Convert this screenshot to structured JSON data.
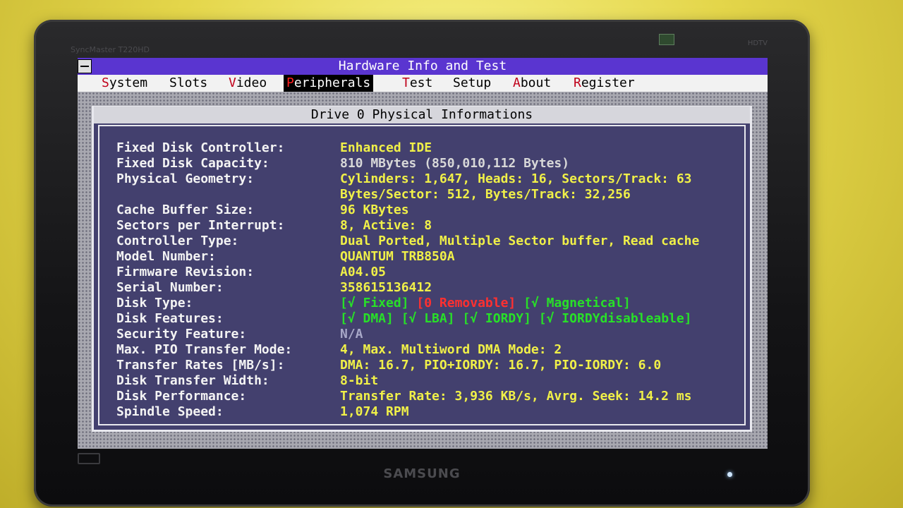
{
  "monitor": {
    "brand": "SAMSUNG",
    "top_left_text": "SyncMaster T220HD",
    "top_right_text": "HDTV"
  },
  "app": {
    "title": "Hardware Info and Test",
    "menu": [
      {
        "hot": "S",
        "rest": "ystem",
        "active": false
      },
      {
        "hot": "",
        "rest": "Slots",
        "active": false
      },
      {
        "hot": "V",
        "rest": "ideo",
        "active": false
      },
      {
        "hot": "P",
        "rest": "eripherals",
        "active": true
      },
      {
        "hot": "T",
        "rest": "est",
        "active": false
      },
      {
        "hot": "",
        "rest": "Setup",
        "active": false
      },
      {
        "hot": "A",
        "rest": "bout",
        "active": false
      },
      {
        "hot": "R",
        "rest": "egister",
        "active": false
      }
    ]
  },
  "window": {
    "title": "Drive 0 Physical Informations"
  },
  "fields": {
    "controller_label": "Fixed Disk Controller:",
    "controller_value": "Enhanced IDE",
    "capacity_label": "Fixed Disk Capacity:",
    "capacity_value": "810 MBytes (850,010,112 Bytes)",
    "geometry_label": "Physical Geometry:",
    "geometry_line1": "Cylinders: 1,647, Heads: 16, Sectors/Track: 63",
    "geometry_line2": "Bytes/Sector: 512, Bytes/Track: 32,256",
    "cache_label": "Cache Buffer Size:",
    "cache_value": "96 KBytes",
    "spi_label": "Sectors per Interrupt:",
    "spi_value": "8, Active: 8",
    "ctype_label": "Controller Type:",
    "ctype_value": "Dual Ported, Multiple Sector buffer, Read cache",
    "model_label": "Model Number:",
    "model_value": "QUANTUM TRB850A",
    "firmware_label": "Firmware Revision:",
    "firmware_value": "A04.05",
    "serial_label": "Serial Number:",
    "serial_value": "358615136412",
    "dtype_label": "Disk Type:",
    "dtype_fixed": "[√ Fixed]",
    "dtype_removable": "[0 Removable]",
    "dtype_magnetical": "[√ Magnetical]",
    "dfeat_label": "Disk Features:",
    "dfeat_dma": "[√ DMA]",
    "dfeat_lba": "[√ LBA]",
    "dfeat_iordy": "[√ IORDY]",
    "dfeat_iordydis": "[√ IORDYdisableable]",
    "security_label": "Security Feature:",
    "security_value": "N/A",
    "pio_label": "Max. PIO Transfer Mode:",
    "pio_value": "4, Max. Multiword DMA Mode: 2",
    "rates_label": "Transfer Rates [MB/s]:",
    "rates_value": "DMA: 16.7, PIO+IORDY: 16.7, PIO-IORDY: 6.0",
    "width_label": "Disk Transfer Width:",
    "width_value": "8-bit",
    "perf_label": "Disk Performance:",
    "perf_value": "Transfer Rate: 3,936 KB/s, Avrg. Seek: 14.2 ms",
    "spindle_label": "Spindle Speed:",
    "spindle_value": "1,074 RPM"
  }
}
